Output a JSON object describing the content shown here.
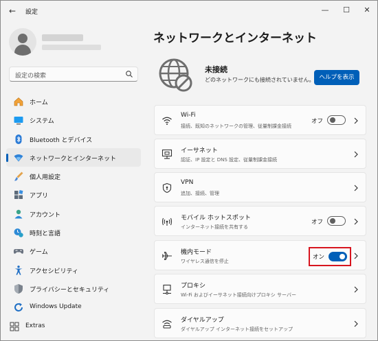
{
  "window": {
    "title": "設定",
    "back": "←",
    "minimize": "—",
    "maximize": "☐",
    "close": "✕"
  },
  "search": {
    "placeholder": "設定の検索"
  },
  "nav": [
    {
      "label": "ホーム",
      "icon": "home-icon"
    },
    {
      "label": "システム",
      "icon": "system-icon"
    },
    {
      "label": "Bluetooth とデバイス",
      "icon": "bluetooth-icon"
    },
    {
      "label": "ネットワークとインターネット",
      "icon": "network-icon",
      "active": true
    },
    {
      "label": "個人用設定",
      "icon": "brush-icon"
    },
    {
      "label": "アプリ",
      "icon": "apps-icon"
    },
    {
      "label": "アカウント",
      "icon": "account-icon"
    },
    {
      "label": "時刻と言語",
      "icon": "time-language-icon"
    },
    {
      "label": "ゲーム",
      "icon": "gamepad-icon"
    },
    {
      "label": "アクセシビリティ",
      "icon": "accessibility-icon"
    },
    {
      "label": "プライバシーとセキュリティ",
      "icon": "shield-icon"
    },
    {
      "label": "Windows Update",
      "icon": "windows-update-icon"
    },
    {
      "label": "Extras",
      "icon": "extras-icon"
    }
  ],
  "main": {
    "title": "ネットワークとインターネット",
    "status": {
      "title": "未接続",
      "subtitle": "どのネットワークにも接続されていません。",
      "button": "ヘルプを表示"
    },
    "cards": [
      {
        "title": "Wi-Fi",
        "subtitle": "接続、既知のネットワークの管理、従量制課金接続",
        "icon": "wifi-icon",
        "toggle": "オフ",
        "on": false
      },
      {
        "title": "イーサネット",
        "subtitle": "認証、IP 設定と DNS 設定、従量制課金接続",
        "icon": "ethernet-icon"
      },
      {
        "title": "VPN",
        "subtitle": "追加、接続、管理",
        "icon": "vpn-shield-icon"
      },
      {
        "title": "モバイル ホットスポット",
        "subtitle": "インターネット接続を共有する",
        "icon": "hotspot-icon",
        "toggle": "オフ",
        "on": false
      },
      {
        "title": "機内モード",
        "subtitle": "ワイヤレス通信を停止",
        "icon": "airplane-icon",
        "toggle": "オン",
        "on": true
      },
      {
        "title": "プロキシ",
        "subtitle": "Wi-Fi およびイーサネット接続向けプロキシ サーバー",
        "icon": "proxy-icon"
      },
      {
        "title": "ダイヤルアップ",
        "subtitle": "ダイヤルアップ インターネット接続をセットアップ",
        "icon": "dialup-icon"
      }
    ]
  },
  "colors": {
    "accent": "#005fb8",
    "highlight": "#d7141e"
  }
}
